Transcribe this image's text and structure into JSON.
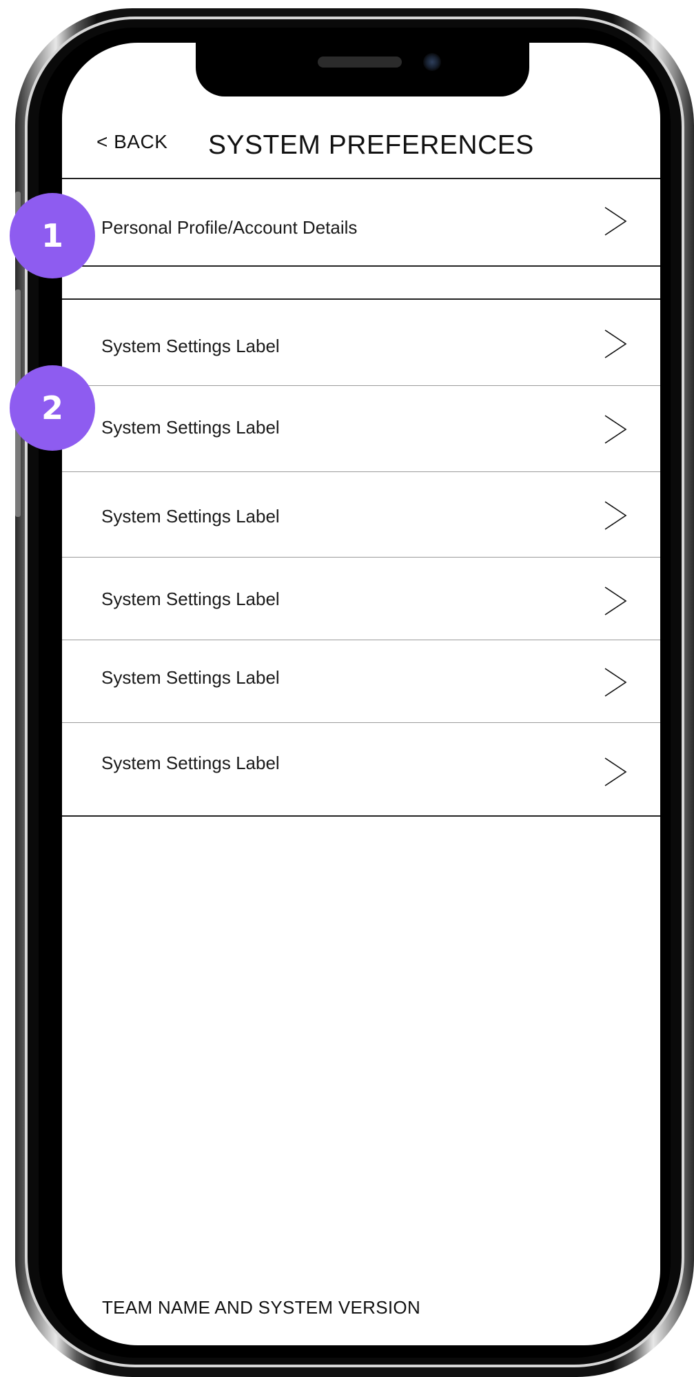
{
  "header": {
    "back_label": "< BACK",
    "title": "SYSTEM PREFERENCES"
  },
  "profile_row": {
    "label": "Personal Profile/Account Details",
    "badge": "1"
  },
  "settings_badge": "2",
  "settings_rows": [
    {
      "label": "System Settings Label"
    },
    {
      "label": "System Settings Label"
    },
    {
      "label": "System Settings Label"
    },
    {
      "label": "System Settings Label"
    },
    {
      "label": "System Settings Label"
    },
    {
      "label": "System Settings Label"
    }
  ],
  "footer": {
    "text": "TEAM NAME AND SYSTEM VERSION"
  },
  "colors": {
    "badge": "#8e5cf0"
  },
  "icons": {
    "row_chevron": "chevron-right-icon"
  }
}
